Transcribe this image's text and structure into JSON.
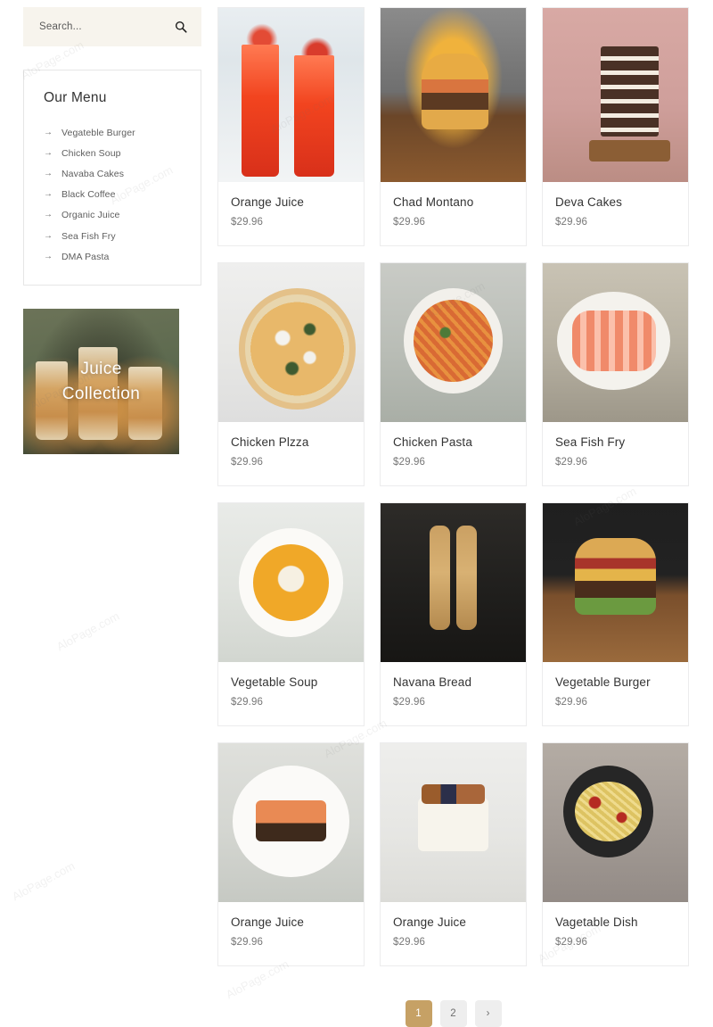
{
  "search": {
    "placeholder": "Search...",
    "value": "",
    "icon": "search-icon"
  },
  "sidebar": {
    "menu_title": "Our Menu",
    "arrow_glyph": "→",
    "items": [
      {
        "label": "Vegateble Burger"
      },
      {
        "label": "Chicken Soup"
      },
      {
        "label": "Navaba Cakes"
      },
      {
        "label": "Black Coffee"
      },
      {
        "label": "Organic Juice"
      },
      {
        "label": "Sea Fish Fry"
      },
      {
        "label": "DMA Pasta"
      }
    ],
    "promo": {
      "line1": "Juice",
      "line2": "Collection"
    }
  },
  "products": [
    {
      "title": "Orange Juice",
      "price": "$29.96",
      "img": "img-juice"
    },
    {
      "title": "Chad Montano",
      "price": "$29.96",
      "img": "img-burger"
    },
    {
      "title": "Deva Cakes",
      "price": "$29.96",
      "img": "img-cake"
    },
    {
      "title": "Chicken Plzza",
      "price": "$29.96",
      "img": "img-pizza"
    },
    {
      "title": "Chicken Pasta",
      "price": "$29.96",
      "img": "img-pasta"
    },
    {
      "title": "Sea Fish Fry",
      "price": "$29.96",
      "img": "img-shrimp"
    },
    {
      "title": "Vegetable Soup",
      "price": "$29.96",
      "img": "img-soup"
    },
    {
      "title": "Navana Bread",
      "price": "$29.96",
      "img": "img-bread"
    },
    {
      "title": "Vegetable Burger",
      "price": "$29.96",
      "img": "img-burger2"
    },
    {
      "title": "Orange Juice",
      "price": "$29.96",
      "img": "img-salmon"
    },
    {
      "title": "Orange Juice",
      "price": "$29.96",
      "img": "img-bcake"
    },
    {
      "title": "Vagetable Dish",
      "price": "$29.96",
      "img": "img-skillet"
    }
  ],
  "pagination": {
    "pages": [
      {
        "label": "1",
        "active": true
      },
      {
        "label": "2",
        "active": false
      }
    ],
    "next_label": "›"
  },
  "colors": {
    "accent": "#c6a165",
    "search_bg": "#f7f4ed",
    "card_border": "#ececed",
    "page_bg": "#ffffff",
    "title_text": "#333333",
    "price_text": "#777777"
  },
  "watermark": {
    "text": "AloPage.com"
  }
}
